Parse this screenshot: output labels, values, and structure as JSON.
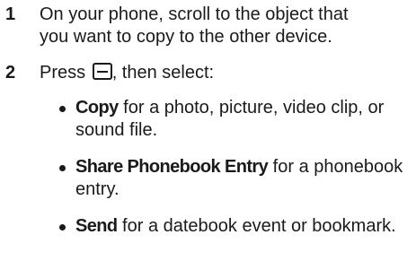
{
  "steps": [
    {
      "number": "1",
      "lines": [
        "On your phone, scroll to the object that",
        "you want to copy to the other device."
      ]
    },
    {
      "number": "2",
      "text_before": "Press",
      "icon": "menu-key-icon",
      "text_after": ", then select:"
    }
  ],
  "bullets": [
    {
      "keyword": "Copy",
      "line1_rest": " for a photo, picture, video clip, or",
      "line2": "sound file."
    },
    {
      "keyword": "Share Phonebook Entry",
      "line1_rest": " for a phonebook",
      "line2": "entry."
    },
    {
      "keyword": "Send",
      "line1_rest": " for a datebook event or bookmark.",
      "line2": ""
    }
  ]
}
